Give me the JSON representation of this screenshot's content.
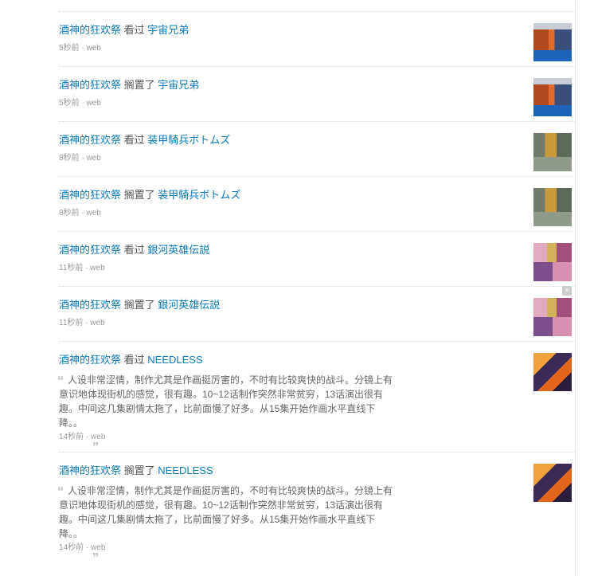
{
  "timeline": {
    "items": [
      {
        "user": "酒神的狂欢祭",
        "action": "看过",
        "subject": "宇宙兄弟",
        "time": "5秒前",
        "source": "web",
        "thumb": "uchuu"
      },
      {
        "user": "酒神的狂欢祭",
        "action": "搁置了",
        "subject": "宇宙兄弟",
        "time": "5秒前",
        "source": "web",
        "thumb": "uchuu"
      },
      {
        "user": "酒神的狂欢祭",
        "action": "看过",
        "subject": "装甲騎兵ボトムズ",
        "time": "8秒前",
        "source": "web",
        "thumb": "votoms"
      },
      {
        "user": "酒神的狂欢祭",
        "action": "搁置了",
        "subject": "装甲騎兵ボトムズ",
        "time": "8秒前",
        "source": "web",
        "thumb": "votoms"
      },
      {
        "user": "酒神的狂欢祭",
        "action": "看过",
        "subject": "銀河英雄伝説",
        "time": "11秒前",
        "source": "web",
        "thumb": "loghs"
      },
      {
        "user": "酒神的狂欢祭",
        "action": "搁置了",
        "subject": "銀河英雄伝説",
        "time": "11秒前",
        "source": "web",
        "thumb": "loghs"
      }
    ],
    "long_items": [
      {
        "user": "酒神的狂欢祭",
        "action": "看过",
        "subject": "NEEDLESS",
        "comment": "人设非常涩情，制作尤其是作画挺厉害的，不时有比较爽快的战斗。分镜上有意识地体现街机的感觉，很有趣。10~12话制作突然非常贫穷，13话演出很有趣。中间这几集剧情太拖了，比前面慢了好多。从15集开始作画水平直线下降。。",
        "time": "14秒前",
        "source": "web",
        "thumb": "needless"
      },
      {
        "user": "酒神的狂欢祭",
        "action": "搁置了",
        "subject": "NEEDLESS",
        "comment": "人设非常涩情，制作尤其是作画挺厉害的，不时有比较爽快的战斗。分镜上有意识地体现街机的感觉，很有趣。10~12话制作突然非常贫穷，13话演出很有趣。中间这几集剧情太拖了，比前面慢了好多。从15集开始作画水平直线下降。。",
        "time": "14秒前",
        "source": "web",
        "thumb": "needless"
      }
    ],
    "meta_separator": "·",
    "open_quote": "“",
    "close_quote": "”",
    "close_icon": "×"
  }
}
